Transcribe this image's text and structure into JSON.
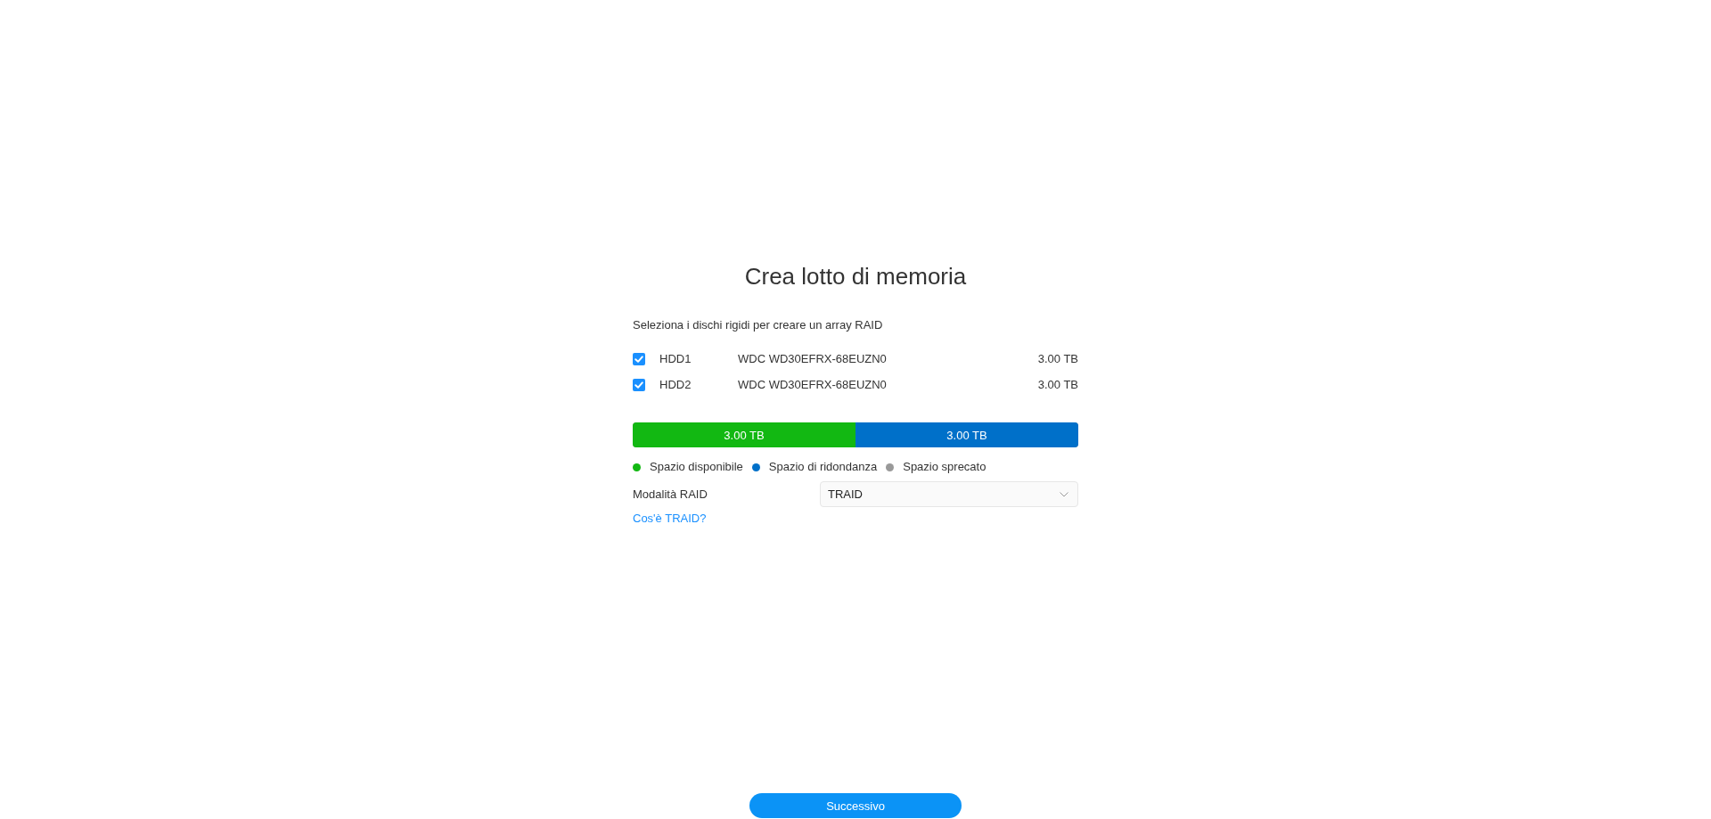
{
  "title": "Crea lotto di memoria",
  "instruction": "Seleziona i dischi rigidi per creare un array RAID",
  "disks": [
    {
      "name": "HDD1",
      "model": "WDC WD30EFRX-68EUZN0",
      "size": "3.00 TB",
      "checked": true
    },
    {
      "name": "HDD2",
      "model": "WDC WD30EFRX-68EUZN0",
      "size": "3.00 TB",
      "checked": true
    }
  ],
  "capacity_bar": {
    "segments": [
      {
        "label": "3.00 TB",
        "color": "#12b812",
        "level": 0.5
      },
      {
        "label": "3.00 TB",
        "color": "#0070c9",
        "level": 0.5
      }
    ]
  },
  "legend": [
    {
      "label": "Spazio disponibile",
      "color": "#12b812"
    },
    {
      "label": "Spazio di ridondanza",
      "color": "#0070c9"
    },
    {
      "label": "Spazio sprecato",
      "color": "#999999"
    }
  ],
  "raid_mode": {
    "label": "Modalità RAID",
    "value": "TRAID"
  },
  "help_link": "Cos'è TRAID?",
  "next_button": "Successivo"
}
